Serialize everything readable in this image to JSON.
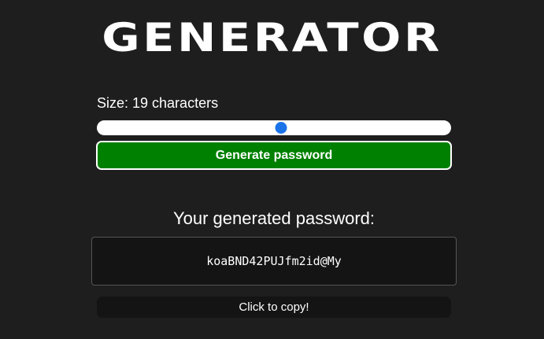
{
  "header": {
    "logo_text": "GENERATOR"
  },
  "size": {
    "label": "Size: 19 characters",
    "slider_value": 0.52
  },
  "generate_button": {
    "label": "Generate password"
  },
  "result": {
    "heading": "Your generated password:",
    "password": "koaBND42PUJfm2id@My"
  },
  "copy_button": {
    "label": "Click to copy!"
  },
  "colors": {
    "background": "#1e1e1e",
    "generate_button": "#008000",
    "slider_thumb": "#1a73e8",
    "panel": "#141414"
  }
}
